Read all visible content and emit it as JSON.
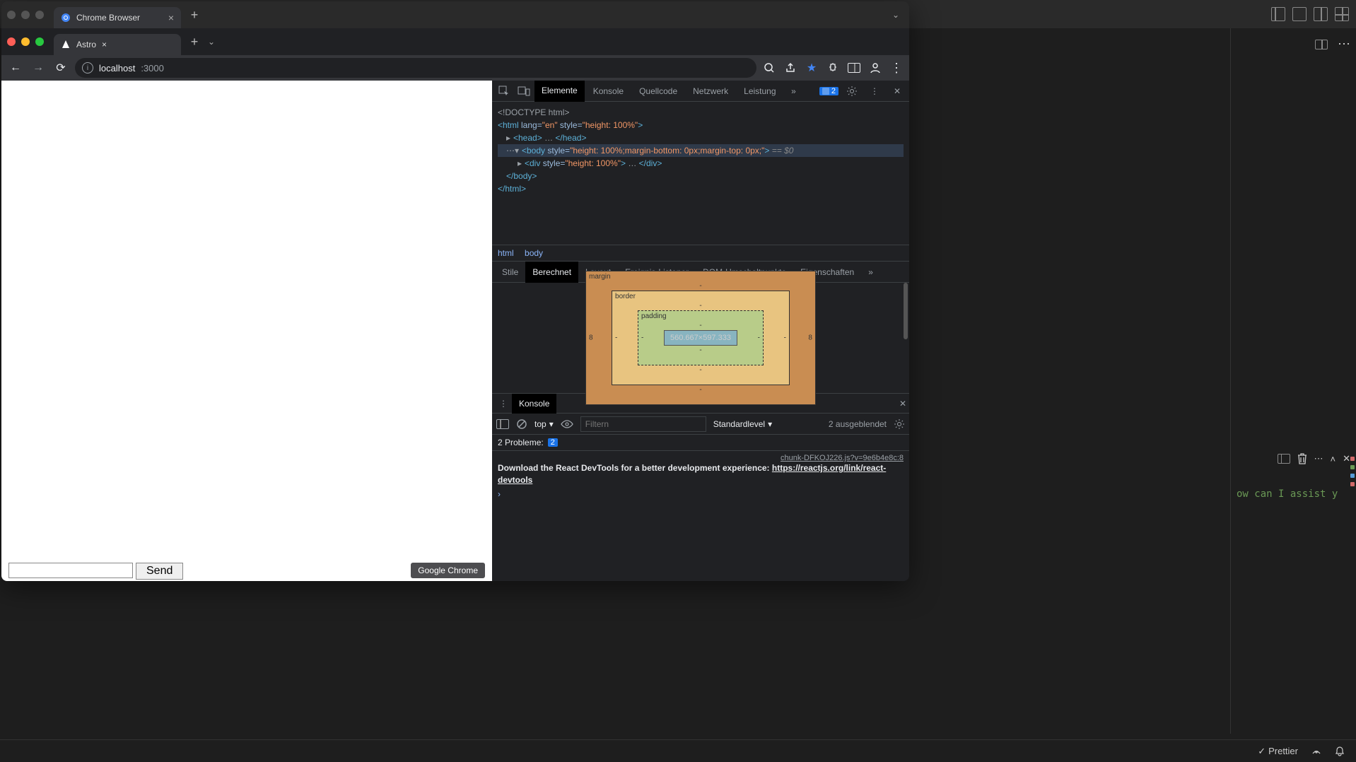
{
  "outer_editor": {
    "side_hint": "ow can I assist y",
    "status_items": {
      "prettier": "Prettier"
    },
    "minimap_colors": [
      "#d16969",
      "#6a9955",
      "#569cd6",
      "#d16969"
    ]
  },
  "outer_chrome": {
    "tab_title": "Chrome Browser"
  },
  "browser": {
    "tab_title": "Astro",
    "url_host": "localhost",
    "url_port": ":3000",
    "dock_tooltip": "Google Chrome"
  },
  "page": {
    "send_button": "Send",
    "input_value": ""
  },
  "devtools": {
    "tabs": [
      "Elemente",
      "Konsole",
      "Quellcode",
      "Netzwerk",
      "Leistung"
    ],
    "active_tab": "Elemente",
    "issue_count": "2",
    "dom": {
      "l1": "<!DOCTYPE html>",
      "l2_open": "<html ",
      "l2_attr1": "lang=",
      "l2_val1": "\"en\"",
      "l2_attr2": " style=",
      "l2_val2": "\"height: 100%\"",
      "l2_close": ">",
      "l3_head": "<head>",
      "l3_dots": "…",
      "l3_headc": "</head>",
      "l4_open": "<body ",
      "l4_attr": "style=",
      "l4_val": "\"height: 100%;margin-bottom: 0px;margin-top: 0px;\"",
      "l4_close": ">",
      "l4_sel": " == $0",
      "l5_open": "<div ",
      "l5_attr": "style=",
      "l5_val": "\"height: 100%\"",
      "l5_close": ">",
      "l5_dots": "…",
      "l5_divc": "</div>",
      "l6": "</body>",
      "l7": "</html>"
    },
    "breadcrumbs": [
      "html",
      "body"
    ],
    "styles_tabs": [
      "Stile",
      "Berechnet",
      "Layout",
      "Ereignis-Listener",
      "DOM-Umschaltpunkte",
      "Eigenschaften"
    ],
    "styles_active": "Berechnet",
    "boxmodel": {
      "margin_label": "margin",
      "border_label": "border",
      "padding_label": "padding",
      "margin": {
        "t": "-",
        "r": "8",
        "b": "-",
        "l": "8"
      },
      "border": {
        "t": "-",
        "r": "-",
        "b": "-",
        "l": "-"
      },
      "padding": {
        "t": "-",
        "r": "-",
        "b": "-",
        "l": "-"
      },
      "content": "560.667×597.333"
    },
    "drawer": {
      "tab": "Konsole",
      "context": "top",
      "filter_placeholder": "Filtern",
      "level_label": "Standardlevel",
      "hidden_label": "2 ausgeblendet",
      "problems_prefix": "2 Probleme:",
      "problems_count": "2",
      "source_link": "chunk-DFKOJ226.js?v=9e6b4e8c:8",
      "msg_text": "Download the React DevTools for a better development experience: ",
      "msg_link": "https://reactjs.org/link/react-devtools"
    }
  }
}
